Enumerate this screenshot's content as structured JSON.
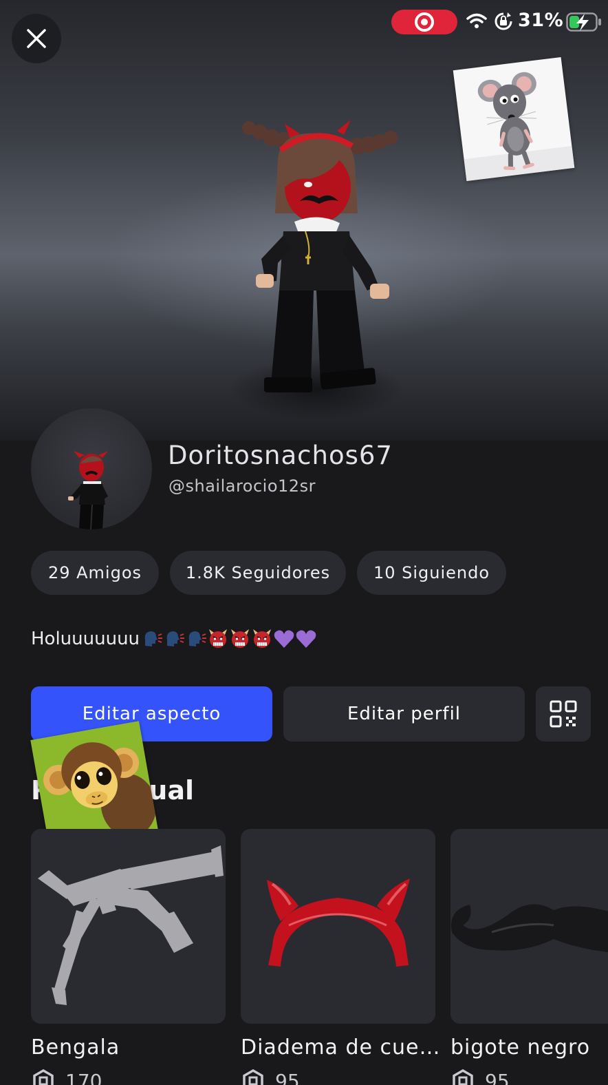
{
  "status_bar": {
    "battery_percent": "31%",
    "recording_color": "#e0243a"
  },
  "profile": {
    "display_name": "Doritosnachos67",
    "username": "@shailarocio12sr",
    "bio_text": "Holuuuuuuu",
    "bio_emojis": [
      "speaking-head-icon",
      "speaking-head-icon",
      "speaking-head-icon",
      "ogre-icon",
      "ogre-icon",
      "ogre-icon",
      "purple-heart-icon",
      "purple-heart-icon"
    ]
  },
  "stats": {
    "friends": "29 Amigos",
    "followers": "1.8K Seguidores",
    "following": "10 Siguiendo"
  },
  "actions": {
    "edit_avatar": "Editar aspecto",
    "edit_profile": "Editar perfil",
    "qr_icon": "qr-code-icon",
    "primary_color": "#3553fb"
  },
  "section": {
    "title": "Ropa actual",
    "visible_title_start": "R",
    "visible_title_end": "ual"
  },
  "items": [
    {
      "name": "Bengala",
      "price": "170"
    },
    {
      "name": "Diadema de cue…",
      "price": "95"
    },
    {
      "name": "bigote negro",
      "price": "95"
    }
  ]
}
